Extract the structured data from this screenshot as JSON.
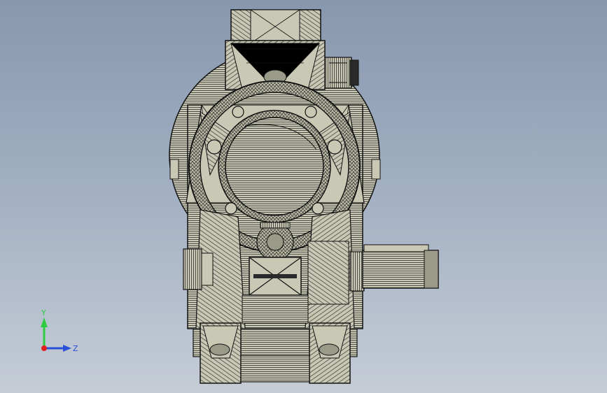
{
  "viewport": {
    "background_top": "#8797ad",
    "background_bottom": "#c5ccd6"
  },
  "model": {
    "body_color": "#c8c8b4",
    "line_color": "#1a1a1a",
    "shade_color": "#9a9a88"
  },
  "triad": {
    "y_label": "Y",
    "z_label": "Z",
    "y_color": "#2ecc40",
    "z_color": "#2a50d8",
    "x_color": "#e02020"
  }
}
